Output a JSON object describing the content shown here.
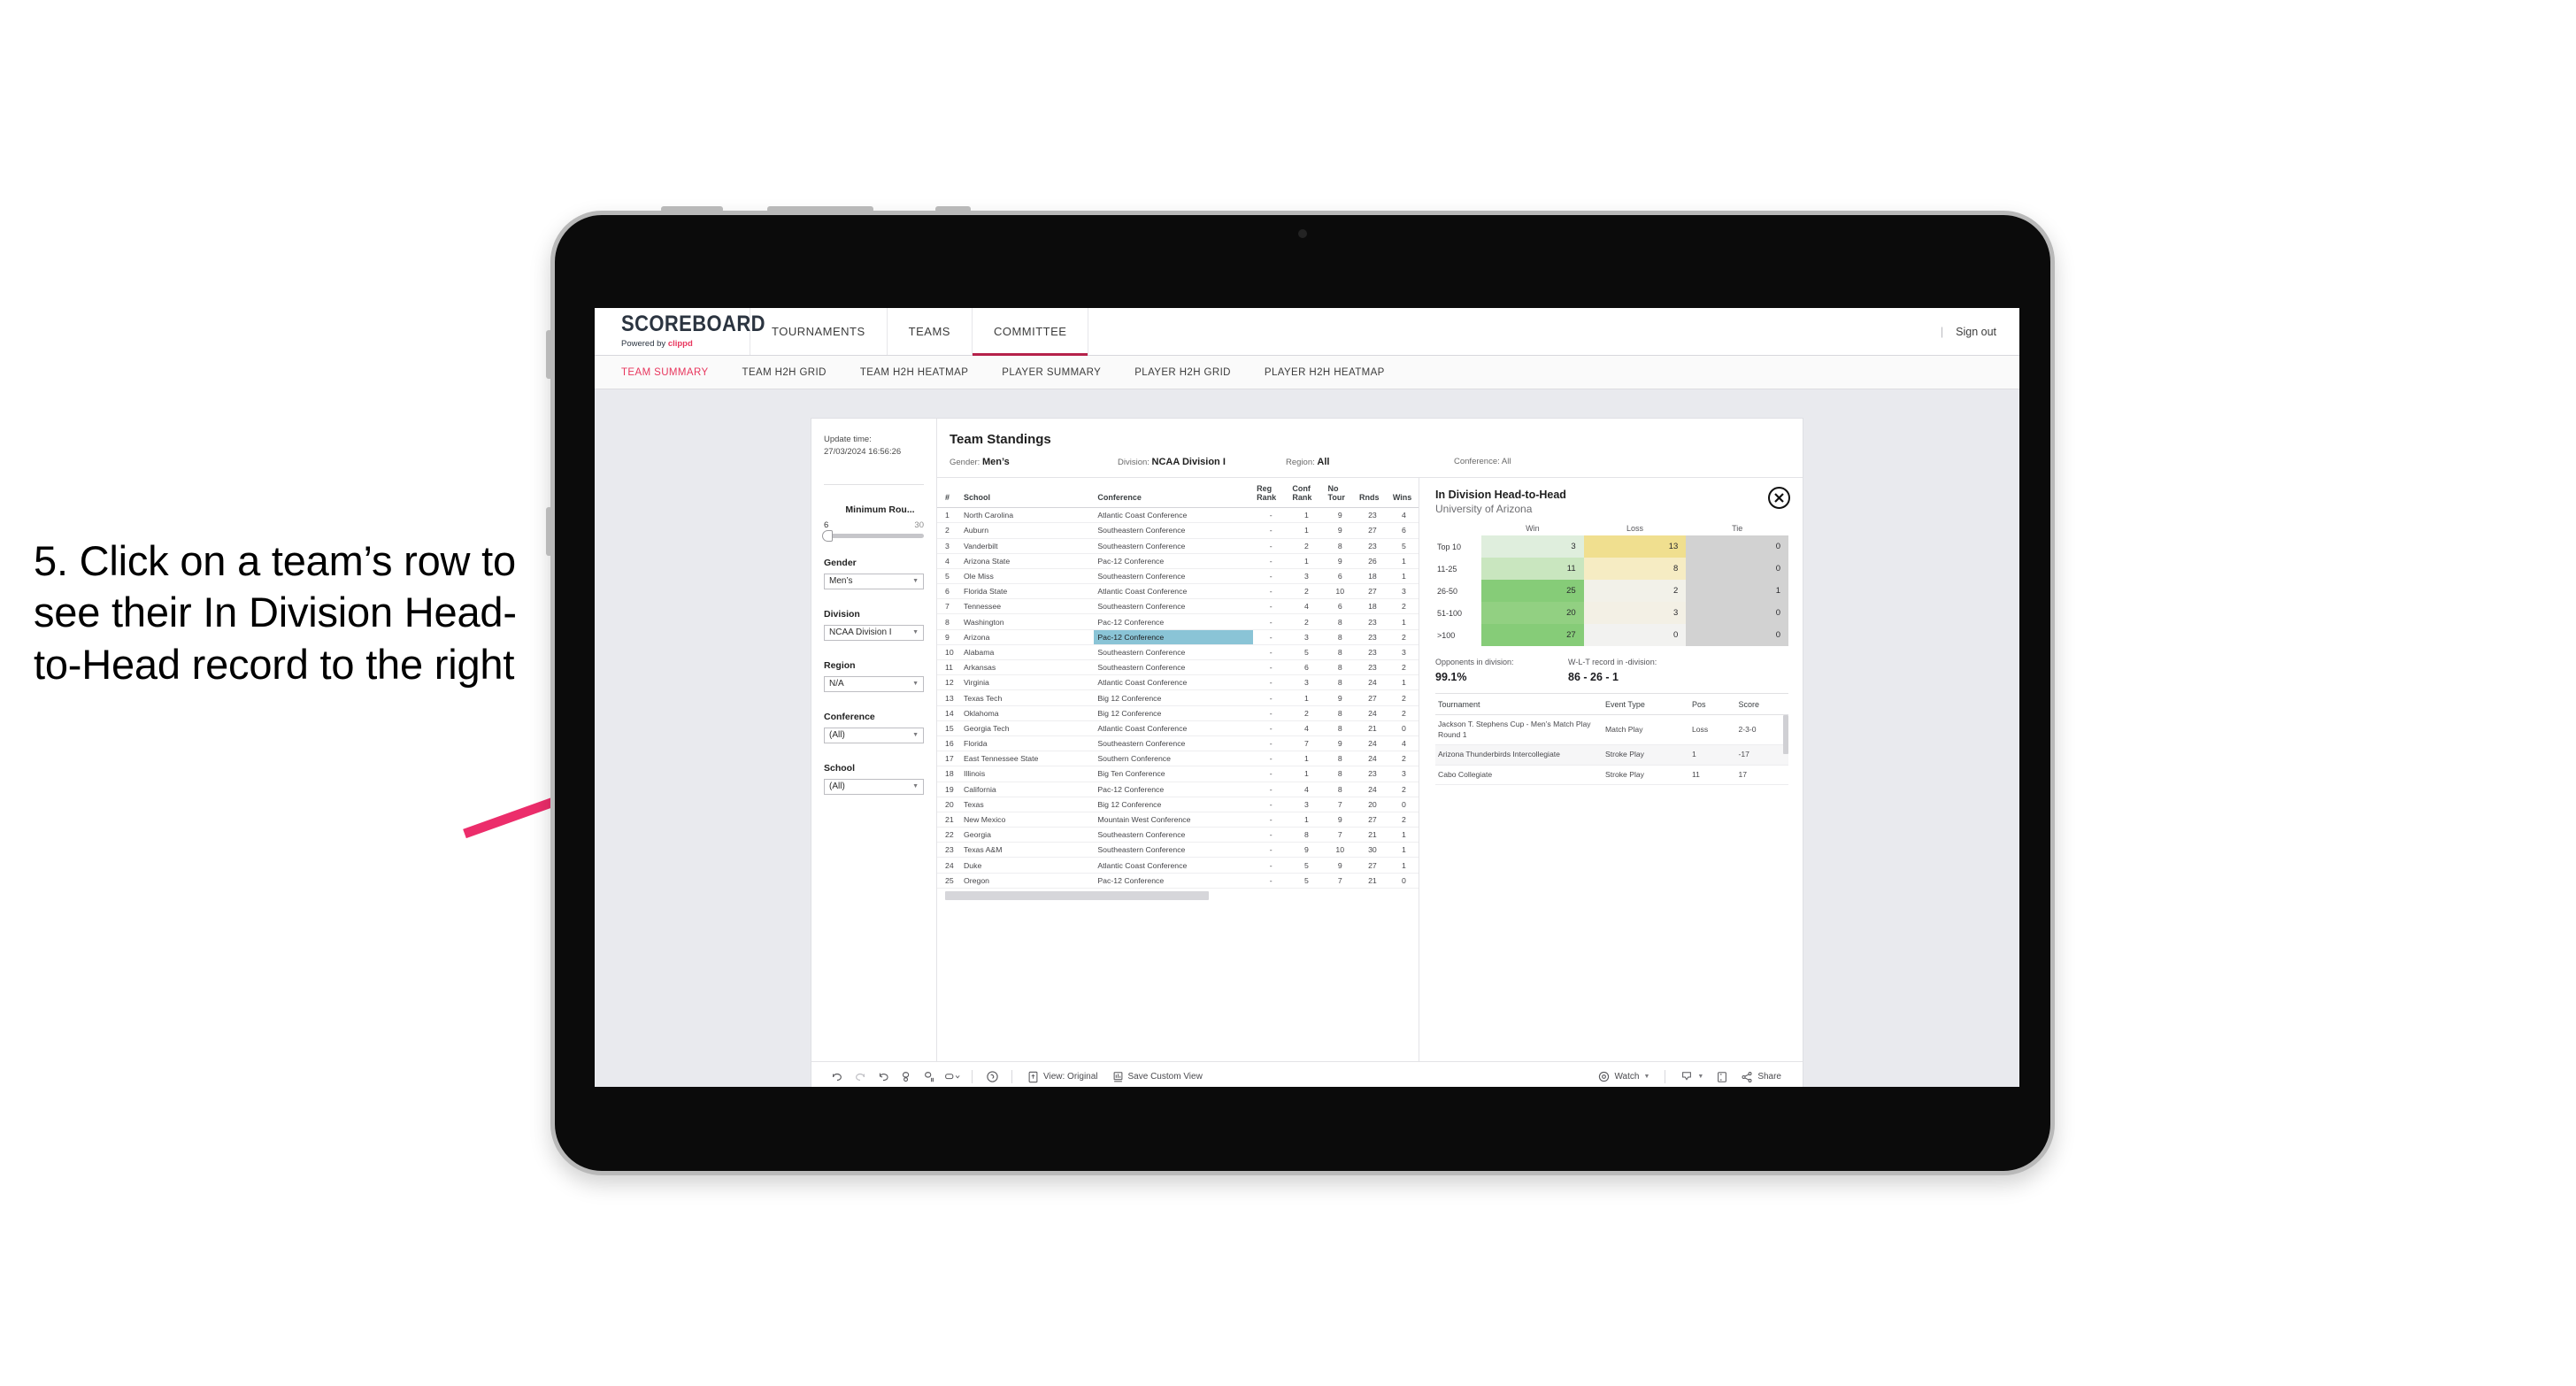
{
  "annotation": {
    "text": "5. Click on a team’s row to see their In Division Head-to-Head record to the right",
    "arrow_color": "#ec2d6b"
  },
  "app": {
    "brand": {
      "title": "SCOREBOARD",
      "powered_prefix": "Powered by ",
      "powered_brand": "clippd"
    },
    "nav": [
      {
        "label": "TOURNAMENTS",
        "active": false
      },
      {
        "label": "TEAMS",
        "active": false
      },
      {
        "label": "COMMITTEE",
        "active": true
      }
    ],
    "header_right": {
      "divider": "|",
      "sign_out": "Sign out"
    },
    "sub_nav": [
      {
        "label": "TEAM SUMMARY",
        "active": true
      },
      {
        "label": "TEAM H2H GRID",
        "active": false
      },
      {
        "label": "TEAM H2H HEATMAP",
        "active": false
      },
      {
        "label": "PLAYER SUMMARY",
        "active": false
      },
      {
        "label": "PLAYER H2H GRID",
        "active": false
      },
      {
        "label": "PLAYER H2H HEATMAP",
        "active": false
      }
    ]
  },
  "filters": {
    "update_time_label": "Update time:",
    "update_time_value": "27/03/2024 16:56:26",
    "min_rounds": {
      "label": "Minimum Rou...",
      "min": "6",
      "max": "30"
    },
    "gender": {
      "label": "Gender",
      "value": "Men’s"
    },
    "division": {
      "label": "Division",
      "value": "NCAA Division I"
    },
    "region": {
      "label": "Region",
      "value": "N/A"
    },
    "conference": {
      "label": "Conference",
      "value": "(All)"
    },
    "school": {
      "label": "School",
      "value": "(All)"
    }
  },
  "viz": {
    "title": "Team Standings",
    "summary": [
      {
        "label": "Gender: ",
        "value": "Men’s"
      },
      {
        "label": "Division: ",
        "value": "NCAA Division I"
      },
      {
        "label": "Region: ",
        "value": "All"
      },
      {
        "label": "Conference: ",
        "value": "All"
      }
    ],
    "table": {
      "headers": [
        "#",
        "School",
        "Conference",
        "Reg Rank",
        "Conf Rank",
        "No Tour",
        "Rnds",
        "Wins"
      ],
      "selected_row_index": 8,
      "rows": [
        [
          "1",
          "North Carolina",
          "Atlantic Coast Conference",
          "-",
          "1",
          "9",
          "23",
          "4"
        ],
        [
          "2",
          "Auburn",
          "Southeastern Conference",
          "-",
          "1",
          "9",
          "27",
          "6"
        ],
        [
          "3",
          "Vanderbilt",
          "Southeastern Conference",
          "-",
          "2",
          "8",
          "23",
          "5"
        ],
        [
          "4",
          "Arizona State",
          "Pac-12 Conference",
          "-",
          "1",
          "9",
          "26",
          "1"
        ],
        [
          "5",
          "Ole Miss",
          "Southeastern Conference",
          "-",
          "3",
          "6",
          "18",
          "1"
        ],
        [
          "6",
          "Florida State",
          "Atlantic Coast Conference",
          "-",
          "2",
          "10",
          "27",
          "3"
        ],
        [
          "7",
          "Tennessee",
          "Southeastern Conference",
          "-",
          "4",
          "6",
          "18",
          "2"
        ],
        [
          "8",
          "Washington",
          "Pac-12 Conference",
          "-",
          "2",
          "8",
          "23",
          "1"
        ],
        [
          "9",
          "Arizona",
          "Pac-12 Conference",
          "-",
          "3",
          "8",
          "23",
          "2"
        ],
        [
          "10",
          "Alabama",
          "Southeastern Conference",
          "-",
          "5",
          "8",
          "23",
          "3"
        ],
        [
          "11",
          "Arkansas",
          "Southeastern Conference",
          "-",
          "6",
          "8",
          "23",
          "2"
        ],
        [
          "12",
          "Virginia",
          "Atlantic Coast Conference",
          "-",
          "3",
          "8",
          "24",
          "1"
        ],
        [
          "13",
          "Texas Tech",
          "Big 12 Conference",
          "-",
          "1",
          "9",
          "27",
          "2"
        ],
        [
          "14",
          "Oklahoma",
          "Big 12 Conference",
          "-",
          "2",
          "8",
          "24",
          "2"
        ],
        [
          "15",
          "Georgia Tech",
          "Atlantic Coast Conference",
          "-",
          "4",
          "8",
          "21",
          "0"
        ],
        [
          "16",
          "Florida",
          "Southeastern Conference",
          "-",
          "7",
          "9",
          "24",
          "4"
        ],
        [
          "17",
          "East Tennessee State",
          "Southern Conference",
          "-",
          "1",
          "8",
          "24",
          "2"
        ],
        [
          "18",
          "Illinois",
          "Big Ten Conference",
          "-",
          "1",
          "8",
          "23",
          "3"
        ],
        [
          "19",
          "California",
          "Pac-12 Conference",
          "-",
          "4",
          "8",
          "24",
          "2"
        ],
        [
          "20",
          "Texas",
          "Big 12 Conference",
          "-",
          "3",
          "7",
          "20",
          "0"
        ],
        [
          "21",
          "New Mexico",
          "Mountain West Conference",
          "-",
          "1",
          "9",
          "27",
          "2"
        ],
        [
          "22",
          "Georgia",
          "Southeastern Conference",
          "-",
          "8",
          "7",
          "21",
          "1"
        ],
        [
          "23",
          "Texas A&M",
          "Southeastern Conference",
          "-",
          "9",
          "10",
          "30",
          "1"
        ],
        [
          "24",
          "Duke",
          "Atlantic Coast Conference",
          "-",
          "5",
          "9",
          "27",
          "1"
        ],
        [
          "25",
          "Oregon",
          "Pac-12 Conference",
          "-",
          "5",
          "7",
          "21",
          "0"
        ]
      ]
    }
  },
  "h2h": {
    "title": "In Division Head-to-Head",
    "subtitle": "University of Arizona",
    "close_icon": "close-icon",
    "columns": [
      "Win",
      "Loss",
      "Tie"
    ],
    "rows": [
      {
        "label": "Top 10",
        "win": "3",
        "loss": "13",
        "tie": "0",
        "win_color": "#dfeedd",
        "loss_color": "#f0df8f",
        "tie_color": "#d2d2d2"
      },
      {
        "label": "11-25",
        "win": "11",
        "loss": "8",
        "tie": "0",
        "win_color": "#c9e6bf",
        "loss_color": "#f6ecc3",
        "tie_color": "#d2d2d2"
      },
      {
        "label": "26-50",
        "win": "25",
        "loss": "2",
        "tie": "1",
        "win_color": "#86cc78",
        "loss_color": "#f2f1e9",
        "tie_color": "#d2d2d2"
      },
      {
        "label": "51-100",
        "win": "20",
        "loss": "3",
        "tie": "0",
        "win_color": "#92d082",
        "loss_color": "#f3f0e5",
        "tie_color": "#d2d2d2"
      },
      {
        "label": ">100",
        "win": "27",
        "loss": "0",
        "tie": "0",
        "win_color": "#86cc78",
        "loss_color": "#f2f2f0",
        "tie_color": "#d2d2d2"
      }
    ],
    "stats": [
      {
        "label": "Opponents in division:",
        "value": "99.1%"
      },
      {
        "label": "W-L-T record in -division:",
        "value": "86 - 26 - 1"
      }
    ],
    "tournaments": {
      "headers": [
        "Tournament",
        "Event Type",
        "Pos",
        "Score"
      ],
      "rows": [
        [
          "Jackson T. Stephens Cup - Men’s Match Play Round 1",
          "Match Play",
          "Loss",
          "2-3-0"
        ],
        [
          "Arizona Thunderbirds Intercollegiate",
          "Stroke Play",
          "1",
          "-17"
        ],
        [
          "Cabo Collegiate",
          "Stroke Play",
          "11",
          "17"
        ]
      ]
    }
  },
  "toolbar": {
    "icons": [
      "undo-icon",
      "redo-icon",
      "revert-icon",
      "refresh-icon",
      "pause-icon",
      "highlight-icon"
    ],
    "alert_icon": "alert-icon",
    "view_label": "View: Original",
    "save_label": "Save Custom View",
    "watch_label": "Watch",
    "download_icon": "download-icon",
    "fullscreen_icon": "fullscreen-icon",
    "share_label": "Share"
  }
}
